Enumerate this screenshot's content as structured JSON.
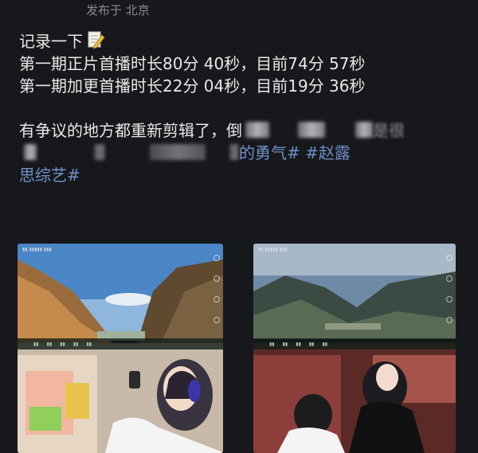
{
  "post": {
    "location": "发布于 北京",
    "line1": "记录一下",
    "line2": "第一期正片首播时长80分 40秒，目前74分 57秒",
    "line3": "第一期加更首播时长22分 04秒，目前19分 36秒",
    "line4_prefix": "有争议的地方都重新剪辑了，",
    "line4_visible": "倒",
    "line4_tail": "是很",
    "line5_tail": "的勇气# #赵露",
    "line6": "思综艺#",
    "memo_icon": "memo-pencil-icon"
  },
  "images": {
    "left": {
      "description_icon": "video-screenshot"
    },
    "right": {
      "description_icon": "video-screenshot"
    }
  },
  "colors": {
    "background": "#17181b",
    "hashtag": "#6f8fc9",
    "meta": "#8a8a8e"
  }
}
